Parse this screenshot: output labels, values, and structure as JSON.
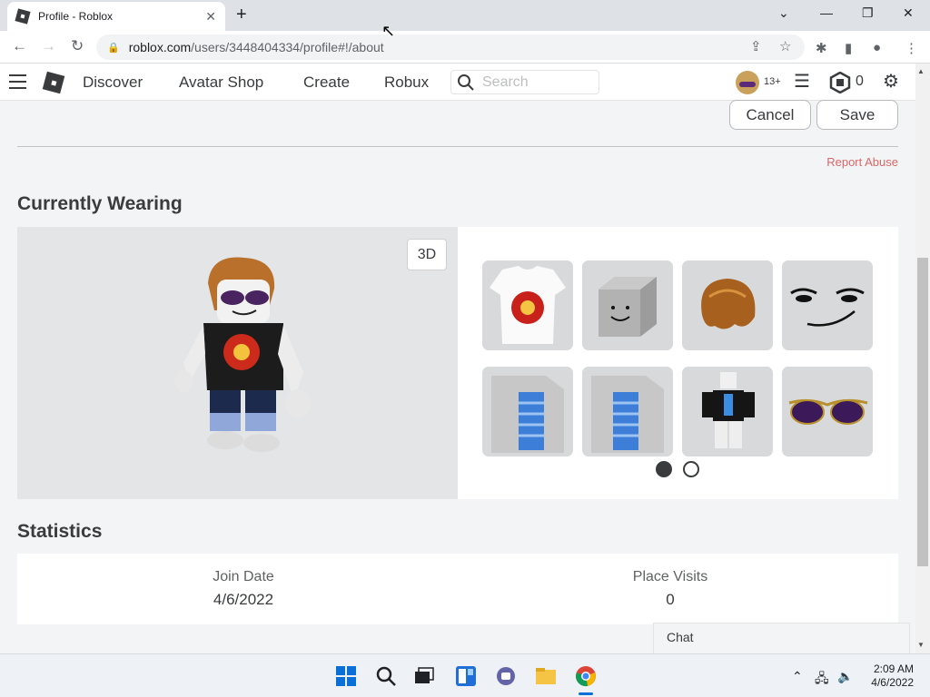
{
  "browser": {
    "tab_title": "Profile - Roblox",
    "url_host": "roblox.com",
    "url_path": "/users/3448404334/profile#!/about"
  },
  "navbar": {
    "links": [
      "Discover",
      "Avatar Shop",
      "Create",
      "Robux"
    ],
    "search_placeholder": "Search",
    "age_badge": "13+",
    "robux_count": "0"
  },
  "actions": {
    "cancel_label": "Cancel",
    "save_label": "Save",
    "report_label": "Report Abuse"
  },
  "wearing": {
    "title": "Currently Wearing",
    "btn_3d": "3D",
    "items": [
      {
        "icon": "tshirt-item-icon"
      },
      {
        "icon": "smile-head-item-icon"
      },
      {
        "icon": "hair-item-icon"
      },
      {
        "icon": "man-face-item-icon"
      },
      {
        "icon": "left-leg-item-icon"
      },
      {
        "icon": "right-leg-item-icon"
      },
      {
        "icon": "outfit-item-icon"
      },
      {
        "icon": "sunglasses-item-icon"
      }
    ],
    "pages": 2,
    "active_page": 1
  },
  "statistics": {
    "title": "Statistics",
    "join_date_label": "Join Date",
    "join_date_value": "4/6/2022",
    "place_visits_label": "Place Visits",
    "place_visits_value": "0"
  },
  "chat": {
    "label": "Chat"
  },
  "taskbar": {
    "time": "2:09 AM",
    "date": "4/6/2022"
  },
  "colors": {
    "accent_report": "#d86868",
    "text_primary": "#393b3d",
    "panel_bg": "#e3e5e7"
  }
}
